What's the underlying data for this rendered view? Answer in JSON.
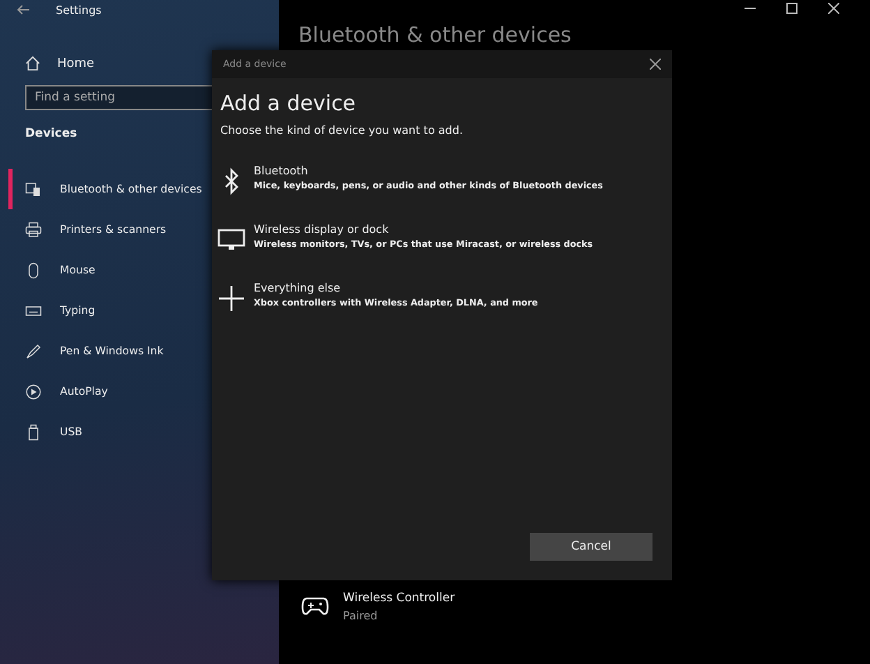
{
  "window": {
    "title": "Settings"
  },
  "sidebar": {
    "home": "Home",
    "search": {
      "placeholder": "Find a setting"
    },
    "section": "Devices",
    "items": [
      {
        "label": "Bluetooth & other devices",
        "kind": "bluetooth-devices",
        "selected": true
      },
      {
        "label": "Printers & scanners",
        "kind": "printer",
        "selected": false
      },
      {
        "label": "Mouse",
        "kind": "mouse",
        "selected": false
      },
      {
        "label": "Typing",
        "kind": "keyboard",
        "selected": false
      },
      {
        "label": "Pen & Windows Ink",
        "kind": "pen",
        "selected": false
      },
      {
        "label": "AutoPlay",
        "kind": "autoplay",
        "selected": false
      },
      {
        "label": "USB",
        "kind": "usb",
        "selected": false
      }
    ]
  },
  "page": {
    "heading": "Bluetooth & other devices",
    "devices": [
      {
        "name": "Wireless Controller",
        "status": "Paired"
      }
    ]
  },
  "dialog": {
    "window_title": "Add a device",
    "title": "Add a device",
    "subtitle": "Choose the kind of device you want to add.",
    "options": [
      {
        "kind": "bluetooth",
        "title": "Bluetooth",
        "description": "Mice, keyboards, pens, or audio and other kinds of Bluetooth devices"
      },
      {
        "kind": "display",
        "title": "Wireless display or dock",
        "description": "Wireless monitors, TVs, or PCs that use Miracast, or wireless docks"
      },
      {
        "kind": "other",
        "title": "Everything else",
        "description": "Xbox controllers with Wireless Adapter, DLNA, and more"
      }
    ],
    "cancel": "Cancel"
  }
}
